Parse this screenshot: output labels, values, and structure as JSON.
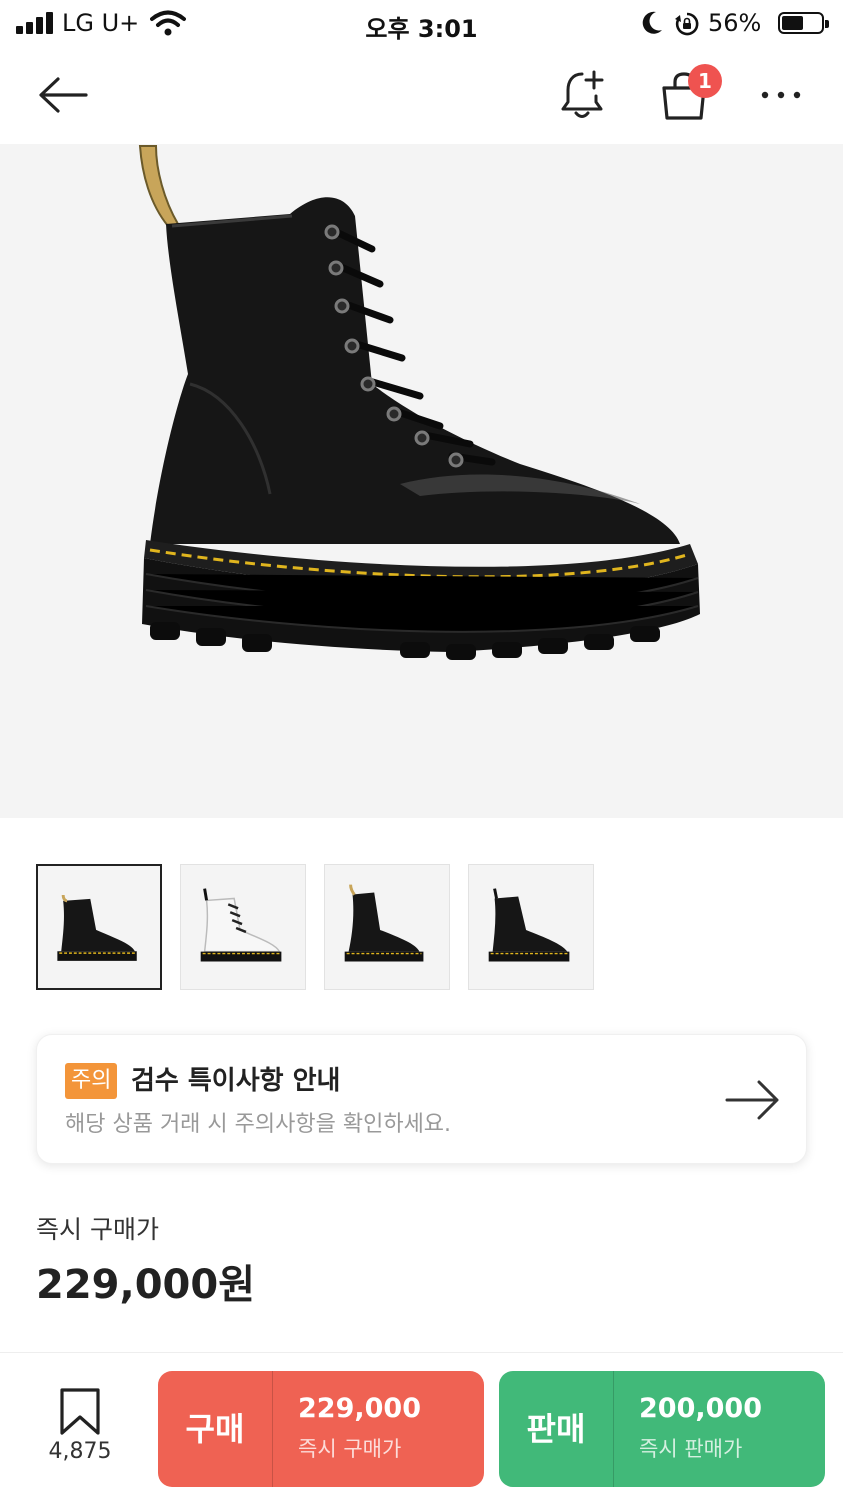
{
  "status_bar": {
    "carrier": "LG U+",
    "time": "오후 3:01",
    "battery": "56%",
    "battery_level": 0.56
  },
  "nav": {
    "cart_badge": "1"
  },
  "thumbnails": [
    {
      "variant": "black",
      "selected": true
    },
    {
      "variant": "white",
      "selected": false
    },
    {
      "variant": "black",
      "selected": false
    },
    {
      "variant": "black",
      "selected": false
    }
  ],
  "notice": {
    "tag": "주의",
    "title": "검수 특이사항 안내",
    "subtitle": "해당 상품 거래 시 주의사항을 확인하세요."
  },
  "price": {
    "label": "즉시 구매가",
    "value": "229,000원"
  },
  "bottom_bar": {
    "wish_count": "4,875",
    "buy": {
      "label": "구매",
      "amount": "229,000",
      "caption": "즉시 구매가"
    },
    "sell": {
      "label": "판매",
      "amount": "200,000",
      "caption": "즉시 판매가"
    }
  },
  "colors": {
    "badge": "#ef5350",
    "notice_tag": "#f3953a",
    "buy": "#ef6253",
    "sell": "#41b979"
  }
}
